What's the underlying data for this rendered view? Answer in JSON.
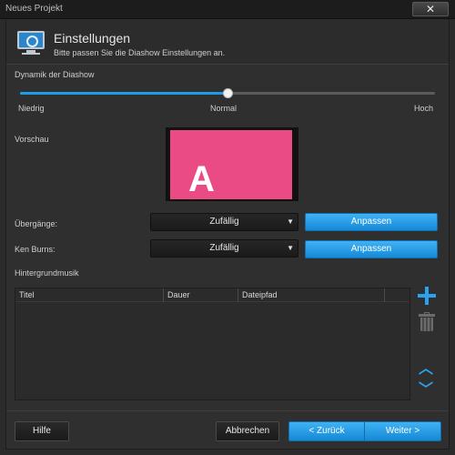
{
  "window": {
    "title": "Neues Projekt",
    "close_glyph": "✕"
  },
  "header": {
    "icon": "monitor-icon",
    "title": "Einstellungen",
    "subtitle": "Bitte passen Sie die Diashow Einstellungen an."
  },
  "dynamics": {
    "label": "Dynamik der Diashow",
    "value_fraction": 0.5,
    "min_label": "Niedrig",
    "mid_label": "Normal",
    "max_label": "Hoch",
    "accent_color": "#1e9be8"
  },
  "preview": {
    "label": "Vorschau",
    "letter": "A",
    "slide_color": "#ea4b84"
  },
  "transitions": {
    "label": "Übergänge:",
    "value": "Zufällig",
    "button": "Anpassen"
  },
  "kenburns": {
    "label": "Ken Burns:",
    "value": "Zufällig",
    "button": "Anpassen"
  },
  "music": {
    "label": "Hintergrundmusik",
    "columns": [
      "Titel",
      "Dauer",
      "Dateipfad"
    ],
    "rows": [],
    "side_icons": [
      "plus-icon",
      "trash-icon",
      "chevron-up-icon",
      "chevron-down-icon"
    ]
  },
  "footer": {
    "help": "Hilfe",
    "cancel": "Abbrechen",
    "back": "< Zurück",
    "next": "Weiter >"
  }
}
